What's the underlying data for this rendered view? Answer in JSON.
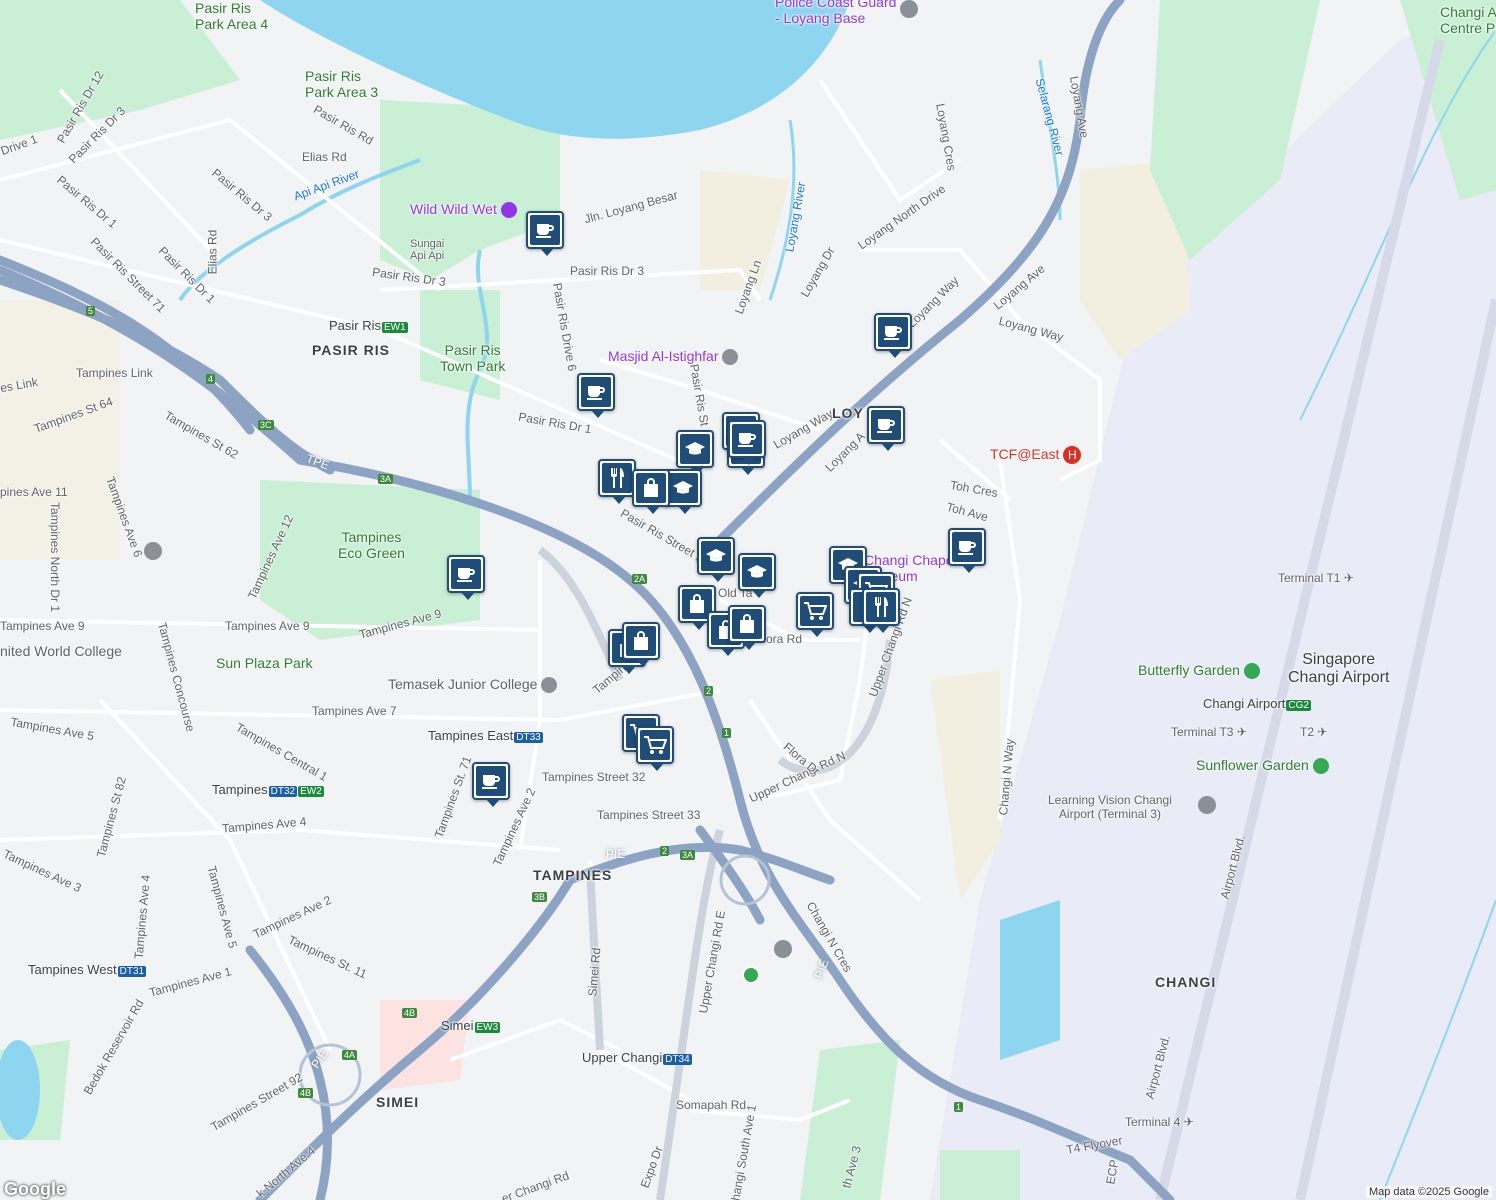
{
  "map": {
    "attribution": "Map data ©2025 Google",
    "logo": "Google",
    "areas": {
      "pasir_ris": "PASIR RIS",
      "tampines": "TAMPINES",
      "changi": "CHANGI",
      "simei": "SIMEI",
      "loyang": "LOY"
    },
    "parks": {
      "pasir_ris_park_area_4": "Pasir Ris\nPark Area 4",
      "pasir_ris_park_area_3": "Pasir Ris\nPark Area 3",
      "pasir_ris_town_park": "Pasir Ris\nTown Park",
      "tampines_eco_green": "Tampines\nEco Green",
      "sun_plaza_park": "Sun Plaza Park",
      "butterfly_garden": "Butterfly Garden",
      "sunflower_garden": "Sunflower Garden",
      "changi_airport_centre": "Changi A\nCentre Pa"
    },
    "pois": {
      "wild_wild_wet": "Wild Wild Wet",
      "masjid": "Masjid Al-Istighfar",
      "changi_chapel": "Changi Chape\nMuseum",
      "tcf_east": "TCF@East",
      "police_coast_guard": "Police Coast Guard\n- Loyang Base",
      "temasek_jc": "Temasek Junior College",
      "united_world_college": "nited World College",
      "learning_vision": "Learning Vision Changi\nAirport (Terminal 3)",
      "sungai_api_api": "Sungai\nApi Api",
      "singapore_changi_airport": "Singapore\nChangi Airport"
    },
    "stations": [
      {
        "name": "Pasir Ris",
        "code": "EW1",
        "line": "ew"
      },
      {
        "name": "Tampines East",
        "code": "DT33",
        "line": "dt"
      },
      {
        "name": "Tampines",
        "code": "DT32",
        "code2": "EW2",
        "line": "dt"
      },
      {
        "name": "Tampines West",
        "code": "DT31",
        "line": "dt"
      },
      {
        "name": "Simei",
        "code": "EW3",
        "line": "ew"
      },
      {
        "name": "Upper Changi",
        "code": "DT34",
        "line": "dt"
      },
      {
        "name": "Changi Airport",
        "code": "CG2",
        "line": "cg"
      }
    ],
    "terminals": {
      "t1": "Terminal T1",
      "t2": "T2",
      "t3": "Terminal T3",
      "t4": "Terminal 4"
    },
    "rivers": {
      "api_api": "Api Api River",
      "loyang": "Loyang River",
      "selarang": "Selarang River"
    },
    "roads": {
      "pasir_ris_dr_12": "Pasir Ris Dr 12",
      "pasir_ris_dr_3_top": "Pasir Ris Dr 3",
      "pasir_ris_rd": "Pasir Ris Rd",
      "elias_rd": "Elias Rd",
      "drive_1": "Drive 1",
      "pasir_ris_dr_1_left": "Pasir Ris Dr 1",
      "pasir_ris_dr_3_mid": "Pasir Ris Dr 3",
      "pasir_ris_street_71": "Pasir Ris Street 71",
      "pasir_ris_dr_1_lower": "Pasir Ris Dr 1",
      "elias_rd_vertical": "Elias Rd",
      "pasir_ris_dr_3_main": "Pasir Ris Dr 3",
      "pasir_ris_dr_3_b": "Pasir Ris Dr 3",
      "jln_loyang_besar": "Jln. Loyang Besar",
      "pasir_ris_drive_6": "Pasir Ris Drive 6",
      "loyang_ln": "Loyang Ln",
      "loyang_dr": "Loyang Dr",
      "loyang_north_drive": "Loyang North Drive",
      "loyang_cres": "Loyang Cres",
      "loyang_way_1": "Loyang Way",
      "loyang_ave": "Loyang Ave",
      "loyang_ave_top": "Loyang Ave",
      "loyang_way_2": "Loyang Way",
      "loyang_way_3": "Loyang Way",
      "loyang_ave_2": "Loyang A",
      "tampines_link": "Tampines Link",
      "es_link": "es Link",
      "tampines_st_64": "Tampines St 64",
      "tampines_st_62": "Tampines St 62",
      "tpe": "TPE",
      "tampines_ave_11": "pines Ave 11",
      "tampines_ave_6": "Tampines Ave 6",
      "tampines_north_dr_1": "Tampines North Dr 1",
      "tampines_ave_12": "Tampines Ave 12",
      "pasir_ris_dr_1_mid": "Pasir Ris Dr 1",
      "pasir_ris_street_11": "Pasir Ris Street 11",
      "pasir_ris_st": "Pasir Ris St",
      "tampines_ave_9_a": "Tampines Ave 9",
      "tampines_ave_9_b": "Tampines Ave 9",
      "tampines_ave_9_c": "Tampines Ave 9",
      "tampines_concourse": "Tampines Concourse",
      "tampines_ave_7": "Tampines Ave 7",
      "tampines_ave_5": "Tampines Ave 5",
      "tampines_central_1": "Tampines Central 1",
      "tampines_st_82": "Tampines St 82",
      "tampines_ave_4_a": "Tampines Ave 4",
      "tampines_ave_3": "Tampines Ave 3",
      "tampines_ave_4_b": "Tampines Ave 4",
      "tampines_ave_5_b": "Tampines Ave 5",
      "tampines_ave_2_a": "Tampines Ave 2",
      "tampines_ave_2_b": "Tampines Ave 2",
      "tampines_st_11": "Tampines St. 11",
      "tampines_st_71": "Tampines St. 71",
      "tampines_ave_1": "Tampines Ave 1",
      "tampines_street_32": "Tampines Street 32",
      "tampines_street_33": "Tampines Street 33",
      "tampines_partial": "Tampin",
      "pie_a": "PIE",
      "pie_b": "PIE",
      "pie_c": "PIE",
      "old_tampines_rd": "Old Ta",
      "flora_rd": "Flora Rd",
      "flora_dr": "Flora Dr",
      "upper_changi_rd_n_a": "Upper Changi Rd N",
      "upper_changi_rd_n_b": "Upper Changi Rd N",
      "upper_changi_rd_e": "Upper Changi Rd E",
      "changi_n_cres": "Changi N Cres",
      "changi_n_way": "Changi N Way",
      "toh_cres": "Toh Cres",
      "toh_ave": "Toh Ave",
      "simei_rd": "Simei Rd",
      "somapah_rd": "Somapah Rd",
      "expo_dr": "Expo Dr",
      "changi_south_ave_1": "Changi South Ave 1",
      "upper_changi_rd_partial": "er Changi Rd",
      "bedok_reservoir_rd": "Bedok Reservoir Rd",
      "tampines_street_92": "Tampines Street 92",
      "bedok_north_ave_4": "k North Ave 4",
      "airport_blvd_a": "Airport Blvd.",
      "airport_blvd_b": "Airport Blvd.",
      "t4_flyover": "T4 Flyover",
      "ecp": "ECP",
      "ave_3": "th Ave 3"
    },
    "route_markers": [
      "5",
      "4",
      "3C",
      "3A",
      "2A",
      "2",
      "1",
      "2",
      "3A",
      "3B",
      "4B",
      "4A",
      "4B",
      "1"
    ]
  },
  "markers": [
    {
      "type": "cafe",
      "icon": "coffee-cup-icon"
    },
    {
      "type": "cafe",
      "icon": "coffee-cup-icon"
    },
    {
      "type": "cafe",
      "icon": "coffee-cup-icon"
    },
    {
      "type": "cafe",
      "icon": "coffee-cup-icon"
    },
    {
      "type": "school",
      "icon": "graduation-cap-icon"
    },
    {
      "type": "school",
      "icon": "graduation-cap-icon"
    },
    {
      "type": "shop",
      "icon": "shopping-bag-icon"
    },
    {
      "type": "shop",
      "icon": "shopping-bag-icon"
    },
    {
      "type": "restaurant",
      "icon": "fork-knife-icon"
    },
    {
      "type": "shop",
      "icon": "shopping-bag-icon"
    },
    {
      "type": "school",
      "icon": "graduation-cap-icon"
    },
    {
      "type": "cafe",
      "icon": "coffee-cup-icon"
    },
    {
      "type": "school",
      "icon": "graduation-cap-icon"
    },
    {
      "type": "school",
      "icon": "graduation-cap-icon"
    },
    {
      "type": "shop",
      "icon": "shopping-bag-icon"
    },
    {
      "type": "shop",
      "icon": "shopping-bag-icon"
    },
    {
      "type": "shop",
      "icon": "shopping-bag-icon"
    },
    {
      "type": "shop",
      "icon": "shopping-bag-icon"
    },
    {
      "type": "grocery",
      "icon": "shopping-cart-icon"
    },
    {
      "type": "school",
      "icon": "graduation-cap-icon"
    },
    {
      "type": "grocery",
      "icon": "shopping-cart-icon"
    },
    {
      "type": "restaurant",
      "icon": "fork-knife-icon"
    },
    {
      "type": "restaurant",
      "icon": "fork-knife-icon"
    },
    {
      "type": "cafe",
      "icon": "coffee-cup-icon"
    },
    {
      "type": "cafe",
      "icon": "coffee-cup-icon"
    },
    {
      "type": "grocery",
      "icon": "shopping-cart-icon"
    },
    {
      "type": "grocery",
      "icon": "shopping-cart-icon"
    },
    {
      "type": "shop",
      "icon": "shopping-bag-icon"
    },
    {
      "type": "cafe",
      "icon": "coffee-cup-icon"
    }
  ],
  "colors": {
    "water": "#8ed6f0",
    "park": "#c9efd4",
    "highway": "#8ca3c3",
    "marker": "#1f4d78"
  }
}
